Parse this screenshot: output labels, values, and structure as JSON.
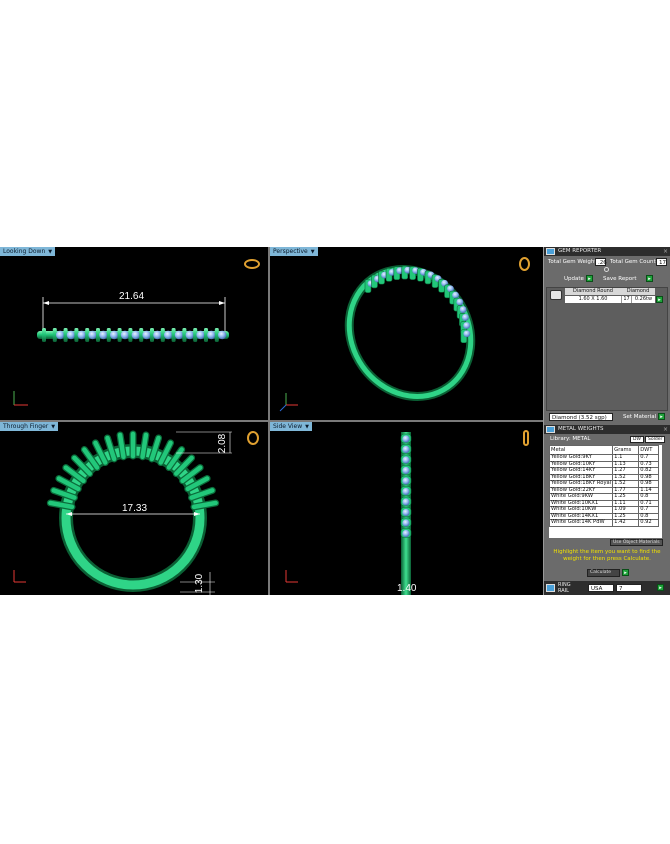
{
  "viewports": {
    "top_left": {
      "label": "Looking Down",
      "dimension": "21.64"
    },
    "top_right": {
      "label": "Perspective"
    },
    "bottom_left": {
      "label": "Through Finger",
      "dimension_main": "17.33",
      "dimension_side": "2.08",
      "dimension_bottom": "1.30"
    },
    "bottom_right": {
      "label": "Side View",
      "dimension": "1.40"
    }
  },
  "gem_reporter": {
    "title": "GEM REPORTER",
    "total_weight_label": "Total Gem Weight",
    "total_weight_value": ".26",
    "total_count_label": "Total Gem Count",
    "total_count_value": "17",
    "update_label": "Update",
    "save_report_label": "Save Report",
    "table_headers": [
      "Diamond Round",
      "Diamond"
    ],
    "gem_row": {
      "size": "1.60 X 1.60",
      "count": "17",
      "weight": "0.26tw"
    },
    "material_select": "Diamond   (3.52 sgp)",
    "set_material_label": "Set Material"
  },
  "metal_weights": {
    "title": "METAL WEIGHTS",
    "library_label": "Library: METAL",
    "unit_options": [
      "DW",
      "Solder"
    ],
    "headers": [
      "Metal",
      "Grams",
      "DWT"
    ],
    "rows": [
      [
        "Yellow Gold:9KY",
        "1.1",
        "0.7"
      ],
      [
        "Yellow Gold:10KY",
        "1.13",
        "0.73"
      ],
      [
        "Yellow Gold:14KY",
        "1.27",
        "0.82"
      ],
      [
        "Yellow Gold:18KY",
        "1.52",
        "0.98"
      ],
      [
        "Yellow Gold:18KY Royal",
        "1.52",
        "0.98"
      ],
      [
        "Yellow Gold:22KY",
        "1.77",
        "1.14"
      ],
      [
        "White Gold:9KW",
        "1.25",
        "0.8"
      ],
      [
        "White Gold:10KX1",
        "1.11",
        "0.71"
      ],
      [
        "White Gold:10KW",
        "1.09",
        "0.7"
      ],
      [
        "White Gold:14KX1",
        "1.25",
        "0.8"
      ],
      [
        "White Gold:14K PdW",
        "1.42",
        "0.92"
      ]
    ],
    "use_object_materials": "Use Object Materials",
    "hint": "Highlight the item you want to find the weight for then press Calculate.",
    "calculate_label": "Calculate"
  },
  "ring_rail": {
    "title": "RING RAIL",
    "country": "USA",
    "size": "7"
  },
  "colors": {
    "metal": "#22c77a",
    "metal_dark": "#0b6b3a",
    "gem": "#8fb8ef",
    "dimension": "#ffffff",
    "panel": "#6b6b6b",
    "hint_text": "#f2e200",
    "label_bg": "#7fb7d8"
  }
}
